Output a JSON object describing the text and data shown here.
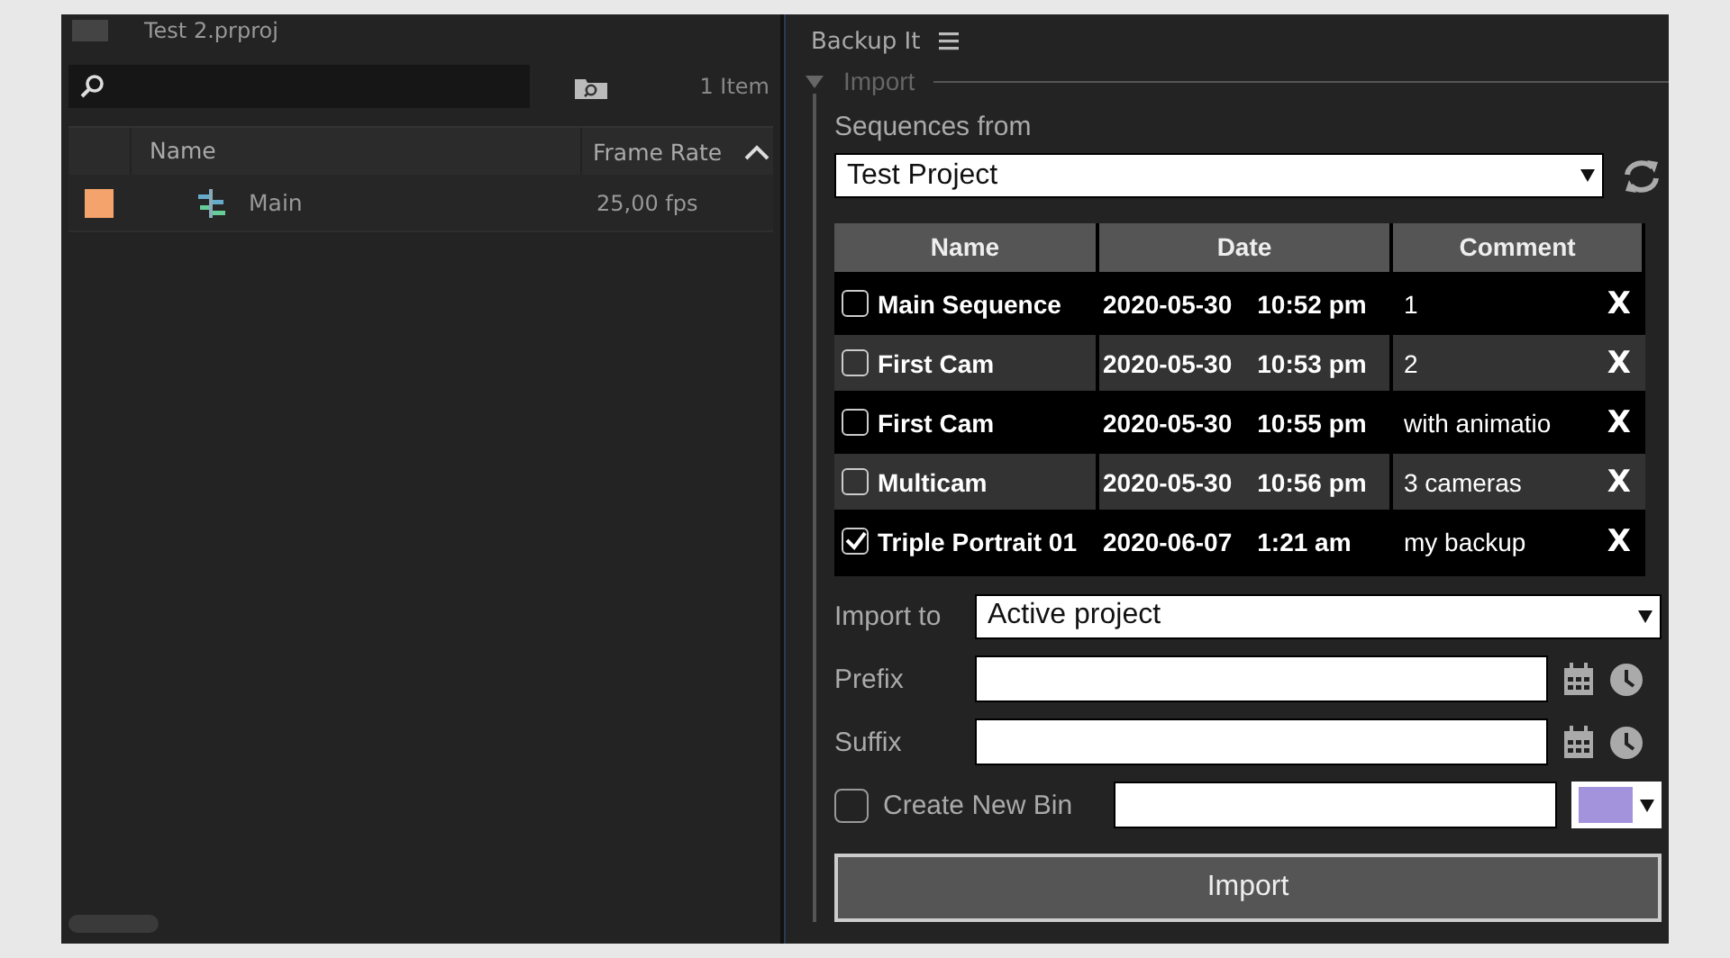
{
  "project_panel": {
    "title": "Test 2.prproj",
    "item_count": "1 Item",
    "columns": [
      "Name",
      "Frame Rate"
    ],
    "rows": [
      {
        "name": "Main",
        "frame_rate": "25,00 fps",
        "color": "#f5a36c"
      }
    ]
  },
  "backup_panel": {
    "title": "Backup It",
    "section": {
      "title": "Import",
      "expanded": true
    },
    "source_label": "Sequences from",
    "source_value": "Test Project",
    "table": {
      "columns": [
        "Name",
        "Date",
        "Comment"
      ],
      "rows": [
        {
          "name": "Main Sequence",
          "date": "2020-05-30",
          "time": "10:52 pm",
          "comment": "1",
          "checked": false,
          "delete": "X"
        },
        {
          "name": "First Cam",
          "date": "2020-05-30",
          "time": "10:53 pm",
          "comment": "2",
          "checked": false,
          "delete": "X"
        },
        {
          "name": "First Cam",
          "date": "2020-05-30",
          "time": "10:55 pm",
          "comment": "with animatio",
          "checked": false,
          "delete": "X"
        },
        {
          "name": "Multicam",
          "date": "2020-05-30",
          "time": "10:56 pm",
          "comment": "3 cameras",
          "checked": false,
          "delete": "X"
        },
        {
          "name": "Triple Portrait 01",
          "date": "2020-06-07",
          "time": "1:21 am",
          "comment": "my backup",
          "checked": true,
          "delete": "X"
        }
      ]
    },
    "import_to_label": "Import to",
    "import_to_value": "Active project",
    "prefix_label": "Prefix",
    "suffix_label": "Suffix",
    "create_bin": {
      "label": "Create New Bin",
      "checked": false,
      "color": "#a393dc"
    },
    "import_button": "Import"
  }
}
